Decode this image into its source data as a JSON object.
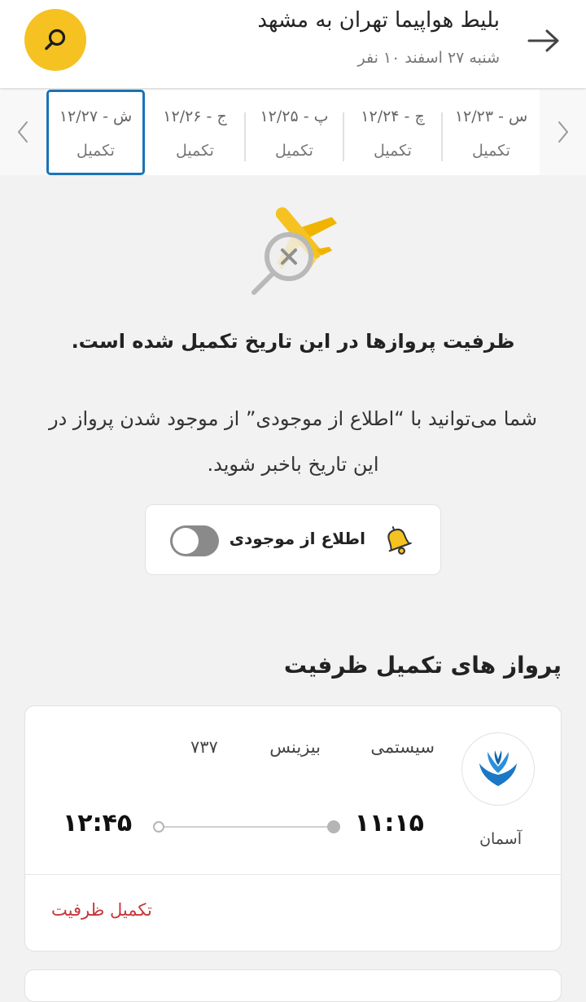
{
  "header": {
    "title": "بلیط هواپیما تهران به مشهد",
    "subtitle": "شنبه ۲۷ اسفند ۱۰ نفر"
  },
  "dates": [
    {
      "date": "ش - ۱۲/۲۷",
      "status": "تکمیل",
      "selected": true
    },
    {
      "date": "ج - ۱۲/۲۶",
      "status": "تکمیل",
      "selected": false
    },
    {
      "date": "پ - ۱۲/۲۵",
      "status": "تکمیل",
      "selected": false
    },
    {
      "date": "چ - ۱۲/۲۴",
      "status": "تکمیل",
      "selected": false
    },
    {
      "date": "س - ۱۲/۲۳",
      "status": "تکمیل",
      "selected": false
    }
  ],
  "empty_state": {
    "title": "ظرفیت پروازها در این تاریخ تکمیل شده است.",
    "line1": "شما می‌توانید با “اطلاع از موجودی” از موجود شدن پرواز در",
    "line2": "این تاریخ باخبر شوید."
  },
  "notify": {
    "label": "اطلاع از موجودی",
    "enabled": false
  },
  "section": {
    "title": "پرواز های تکمیل ظرفیت"
  },
  "flight": {
    "airline": "آسمان",
    "ticket_type": "سیستمی",
    "cabin_class": "بیزینس",
    "aircraft": "۷۳۷",
    "departure_time": "۱۱:۱۵",
    "arrival_time": "۱۲:۴۵",
    "status": "تکمیل ظرفیت"
  },
  "colors": {
    "accent": "#f5c221",
    "selected_border": "#1a73b8",
    "status_full": "#c7373a",
    "airline_brand": "#1b78c5"
  }
}
